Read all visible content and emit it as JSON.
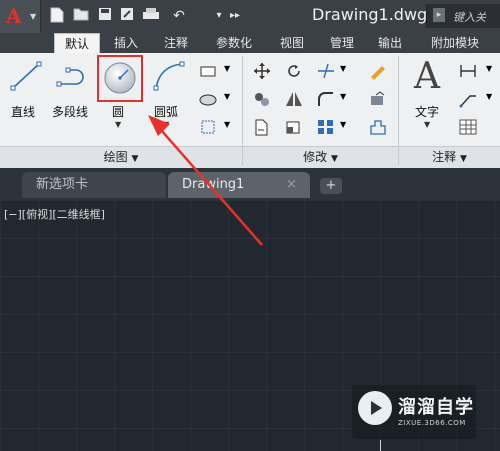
{
  "title_bar": {
    "app_logo_letter": "A",
    "document_title": "Drawing1.dwg",
    "search_placeholder": "键入关",
    "quick_access": [
      "new-file-icon",
      "open-folder-icon",
      "save-icon",
      "save-as-icon",
      "print-icon",
      "undo-icon",
      "more-icon"
    ]
  },
  "ribbon_tabs": [
    {
      "label": "默认",
      "active": true
    },
    {
      "label": "插入",
      "active": false
    },
    {
      "label": "注释",
      "active": false
    },
    {
      "label": "参数化",
      "active": false
    },
    {
      "label": "视图",
      "active": false
    },
    {
      "label": "管理",
      "active": false
    },
    {
      "label": "输出",
      "active": false
    },
    {
      "label": "附加模块",
      "active": false
    }
  ],
  "panels": {
    "draw": {
      "title": "绘图",
      "tools": {
        "line": "直线",
        "polyline": "多段线",
        "circle": "圆",
        "arc": "圆弧"
      }
    },
    "modify": {
      "title": "修改"
    },
    "annotation": {
      "title": "注释",
      "text_label": "文字"
    }
  },
  "doc_tabs": [
    {
      "label": "新选项卡",
      "active": false
    },
    {
      "label": "Drawing1",
      "active": true
    }
  ],
  "add_tab_symbol": "+",
  "close_symbol": "×",
  "viewport_label": "[−][俯视][二维线框]",
  "watermark": {
    "title": "溜溜自学",
    "subtitle": "ZIXUE.3D66.COM"
  },
  "colors": {
    "highlight": "#e0312d",
    "arrow": "#e8312d",
    "accent": "#1f7fd6"
  }
}
